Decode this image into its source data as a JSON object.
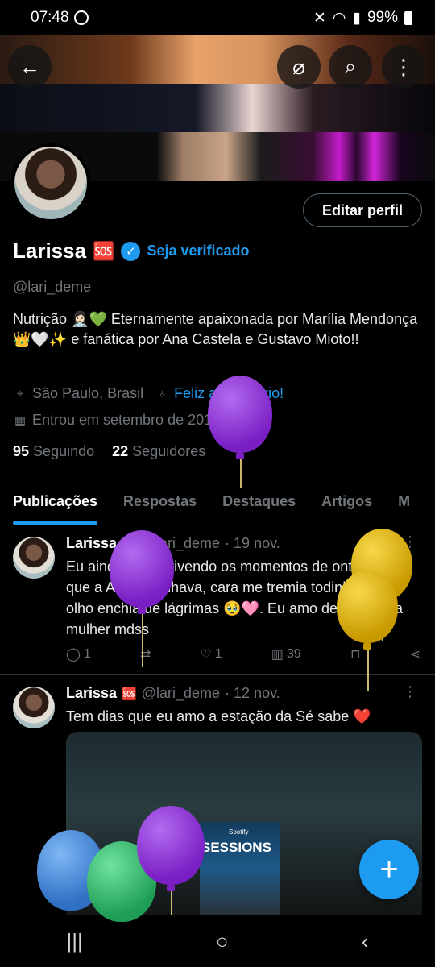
{
  "status_bar": {
    "time": "07:48",
    "battery": "99%"
  },
  "top_actions": {
    "back": "←",
    "grok": "⌀",
    "search": "⌕",
    "more": "⋮"
  },
  "profile": {
    "edit_button": "Editar perfil",
    "name": "Larissa",
    "name_badge": "🆘",
    "verify_cta": "Seja verificado",
    "handle": "@lari_deme",
    "bio": "Nutrição 👩🏻‍⚕️💚 Eternamente apaixonada por Marília Mendonça 👑🤍✨ e fanática por Ana Castela e Gustavo Mioto!!",
    "location": "São Paulo, Brasil",
    "birthday_link": "Feliz aniversário!",
    "joined": "Entrou em setembro de 2017",
    "following_count": "95",
    "following_label": "Seguindo",
    "followers_count": "22",
    "followers_label": "Seguidores"
  },
  "tabs": [
    "Publicações",
    "Respostas",
    "Destaques",
    "Artigos",
    "M"
  ],
  "posts": [
    {
      "name": "Larissa",
      "badge": "🆘",
      "handle": "@lari_deme",
      "date": "· 19 nov.",
      "text": "Eu ainda estou vivendo os momentos de ontem em que a Ana me olhava, cara me tremia todinha e meu olho enchia de lágrimas 🥹🩷. Eu amo demais essa mulher mdss",
      "replies": "1",
      "likes": "1",
      "views": "39"
    },
    {
      "name": "Larissa",
      "badge": "🆘",
      "handle": "@lari_deme",
      "date": "· 12 nov.",
      "text": "Tem dias que eu amo a estação da Sé sabe ❤️",
      "media_text": "SESSIONS",
      "media_brand": "Spotify"
    }
  ],
  "fab": "+",
  "nav": {
    "recents": "|||",
    "home": "○",
    "back": "‹"
  },
  "colors": {
    "accent": "#1d9bf0",
    "balloon_purple": "#8a2be2",
    "balloon_yellow": "#e6b800",
    "balloon_blue": "#3a8ee6",
    "balloon_green": "#2ecc71"
  }
}
